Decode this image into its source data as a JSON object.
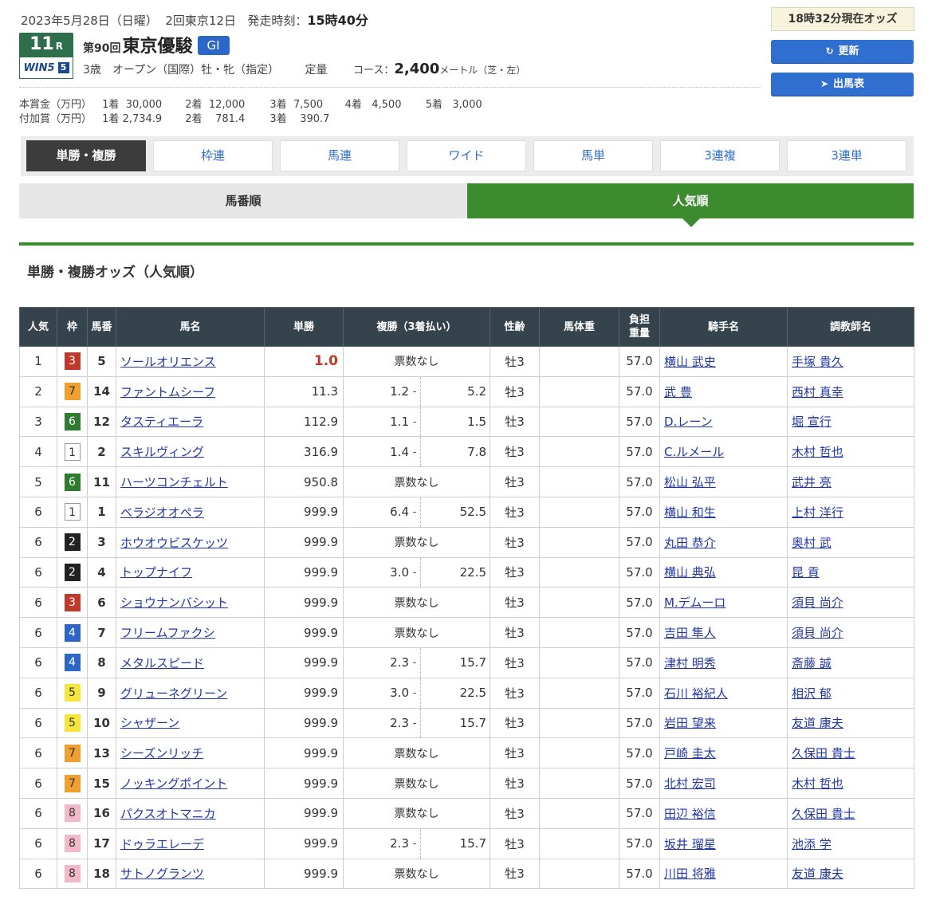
{
  "header": {
    "date": "2023年5月28日（日曜）",
    "meeting": "2回東京12日",
    "post_label": "発走時刻：",
    "post_time": "15時40分",
    "race_no": "11",
    "race_suffix": "R",
    "win5_text": "WIN5",
    "win5_num": "5",
    "race_kai": "第90回",
    "race_name": "東京優駿",
    "grade": "GI",
    "conditions": "3歳　オープン（国際）牡・牝（指定）",
    "weight_rule": "定量",
    "course_label": "コース：",
    "distance": "2,400",
    "distance_unit": "メートル（芝・左）",
    "odds_time": "18時32分現在オッズ",
    "refresh_label": "更新",
    "entries_label": "出馬表"
  },
  "prize": {
    "main_label": "本賞金（万円）",
    "main": [
      [
        "1着",
        "30,000"
      ],
      [
        "2着",
        "12,000"
      ],
      [
        "3着",
        "7,500"
      ],
      [
        "4着",
        "4,500"
      ],
      [
        "5着",
        "3,000"
      ]
    ],
    "add_label": "付加賞（万円）",
    "add": [
      [
        "1着",
        "2,734.9"
      ],
      [
        "2着",
        "781.4"
      ],
      [
        "3着",
        "390.7"
      ]
    ]
  },
  "bet_tabs": [
    "単勝・複勝",
    "枠連",
    "馬連",
    "ワイド",
    "馬単",
    "3連複",
    "3連単"
  ],
  "sort_tabs": [
    "馬番順",
    "人気順"
  ],
  "section_title": "単勝・複勝オッズ（人気順）",
  "table": {
    "headers": [
      "人気",
      "枠",
      "馬番",
      "馬名",
      "単勝",
      "複勝（3着払い）",
      "性齢",
      "馬体重",
      "負担重量",
      "騎手名",
      "調教師名"
    ],
    "no_votes": "票数なし",
    "rows": [
      {
        "pop": "1",
        "waku": "3",
        "num": "5",
        "horse": "ソールオリエンス",
        "win": "1.0",
        "fmin": "",
        "fmax": "",
        "age": "牡3",
        "bw": "",
        "wt": "57.0",
        "jockey": "横山 武史",
        "trainer": "手塚 貴久"
      },
      {
        "pop": "2",
        "waku": "7",
        "num": "14",
        "horse": "ファントムシーフ",
        "win": "11.3",
        "fmin": "1.2",
        "fmax": "5.2",
        "age": "牡3",
        "bw": "",
        "wt": "57.0",
        "jockey": "武 豊",
        "trainer": "西村 真幸"
      },
      {
        "pop": "3",
        "waku": "6",
        "num": "12",
        "horse": "タスティエーラ",
        "win": "112.9",
        "fmin": "1.1",
        "fmax": "1.5",
        "age": "牡3",
        "bw": "",
        "wt": "57.0",
        "jockey": "D.レーン",
        "trainer": "堀 宣行"
      },
      {
        "pop": "4",
        "waku": "1",
        "num": "2",
        "horse": "スキルヴィング",
        "win": "316.9",
        "fmin": "1.4",
        "fmax": "7.8",
        "age": "牡3",
        "bw": "",
        "wt": "57.0",
        "jockey": "C.ルメール",
        "trainer": "木村 哲也"
      },
      {
        "pop": "5",
        "waku": "6",
        "num": "11",
        "horse": "ハーツコンチェルト",
        "win": "950.8",
        "fmin": "",
        "fmax": "",
        "age": "牡3",
        "bw": "",
        "wt": "57.0",
        "jockey": "松山 弘平",
        "trainer": "武井 亮"
      },
      {
        "pop": "6",
        "waku": "1",
        "num": "1",
        "horse": "ベラジオオペラ",
        "win": "999.9",
        "fmin": "6.4",
        "fmax": "52.5",
        "age": "牡3",
        "bw": "",
        "wt": "57.0",
        "jockey": "横山 和生",
        "trainer": "上村 洋行"
      },
      {
        "pop": "6",
        "waku": "2",
        "num": "3",
        "horse": "ホウオウビスケッツ",
        "win": "999.9",
        "fmin": "",
        "fmax": "",
        "age": "牡3",
        "bw": "",
        "wt": "57.0",
        "jockey": "丸田 恭介",
        "trainer": "奥村 武"
      },
      {
        "pop": "6",
        "waku": "2",
        "num": "4",
        "horse": "トップナイフ",
        "win": "999.9",
        "fmin": "3.0",
        "fmax": "22.5",
        "age": "牡3",
        "bw": "",
        "wt": "57.0",
        "jockey": "横山 典弘",
        "trainer": "昆 貢"
      },
      {
        "pop": "6",
        "waku": "3",
        "num": "6",
        "horse": "ショウナンバシット",
        "win": "999.9",
        "fmin": "",
        "fmax": "",
        "age": "牡3",
        "bw": "",
        "wt": "57.0",
        "jockey": "M.デムーロ",
        "trainer": "須貝 尚介"
      },
      {
        "pop": "6",
        "waku": "4",
        "num": "7",
        "horse": "フリームファクシ",
        "win": "999.9",
        "fmin": "",
        "fmax": "",
        "age": "牡3",
        "bw": "",
        "wt": "57.0",
        "jockey": "吉田 隼人",
        "trainer": "須貝 尚介"
      },
      {
        "pop": "6",
        "waku": "4",
        "num": "8",
        "horse": "メタルスピード",
        "win": "999.9",
        "fmin": "2.3",
        "fmax": "15.7",
        "age": "牡3",
        "bw": "",
        "wt": "57.0",
        "jockey": "津村 明秀",
        "trainer": "斎藤 誠"
      },
      {
        "pop": "6",
        "waku": "5",
        "num": "9",
        "horse": "グリューネグリーン",
        "win": "999.9",
        "fmin": "3.0",
        "fmax": "22.5",
        "age": "牡3",
        "bw": "",
        "wt": "57.0",
        "jockey": "石川 裕紀人",
        "trainer": "相沢 郁"
      },
      {
        "pop": "6",
        "waku": "5",
        "num": "10",
        "horse": "シャザーン",
        "win": "999.9",
        "fmin": "2.3",
        "fmax": "15.7",
        "age": "牡3",
        "bw": "",
        "wt": "57.0",
        "jockey": "岩田 望来",
        "trainer": "友道 康夫"
      },
      {
        "pop": "6",
        "waku": "7",
        "num": "13",
        "horse": "シーズンリッチ",
        "win": "999.9",
        "fmin": "",
        "fmax": "",
        "age": "牡3",
        "bw": "",
        "wt": "57.0",
        "jockey": "戸崎 圭太",
        "trainer": "久保田 貴士"
      },
      {
        "pop": "6",
        "waku": "7",
        "num": "15",
        "horse": "ノッキングポイント",
        "win": "999.9",
        "fmin": "",
        "fmax": "",
        "age": "牡3",
        "bw": "",
        "wt": "57.0",
        "jockey": "北村 宏司",
        "trainer": "木村 哲也"
      },
      {
        "pop": "6",
        "waku": "8",
        "num": "16",
        "horse": "パクスオトマニカ",
        "win": "999.9",
        "fmin": "",
        "fmax": "",
        "age": "牡3",
        "bw": "",
        "wt": "57.0",
        "jockey": "田辺 裕信",
        "trainer": "久保田 貴士"
      },
      {
        "pop": "6",
        "waku": "8",
        "num": "17",
        "horse": "ドゥラエレーデ",
        "win": "999.9",
        "fmin": "2.3",
        "fmax": "15.7",
        "age": "牡3",
        "bw": "",
        "wt": "57.0",
        "jockey": "坂井 瑠星",
        "trainer": "池添 学"
      },
      {
        "pop": "6",
        "waku": "8",
        "num": "18",
        "horse": "サトノグランツ",
        "win": "999.9",
        "fmin": "",
        "fmax": "",
        "age": "牡3",
        "bw": "",
        "wt": "57.0",
        "jockey": "川田 将雅",
        "trainer": "友道 康夫"
      }
    ]
  },
  "colors": {
    "brand_green": "#3d8b2f",
    "button_blue": "#2f6fd0",
    "header_dark": "#34434c",
    "favorite_red": "#c0392b"
  },
  "icons": {
    "refresh": "refresh-icon",
    "entries": "arrow-right-circle-icon"
  }
}
